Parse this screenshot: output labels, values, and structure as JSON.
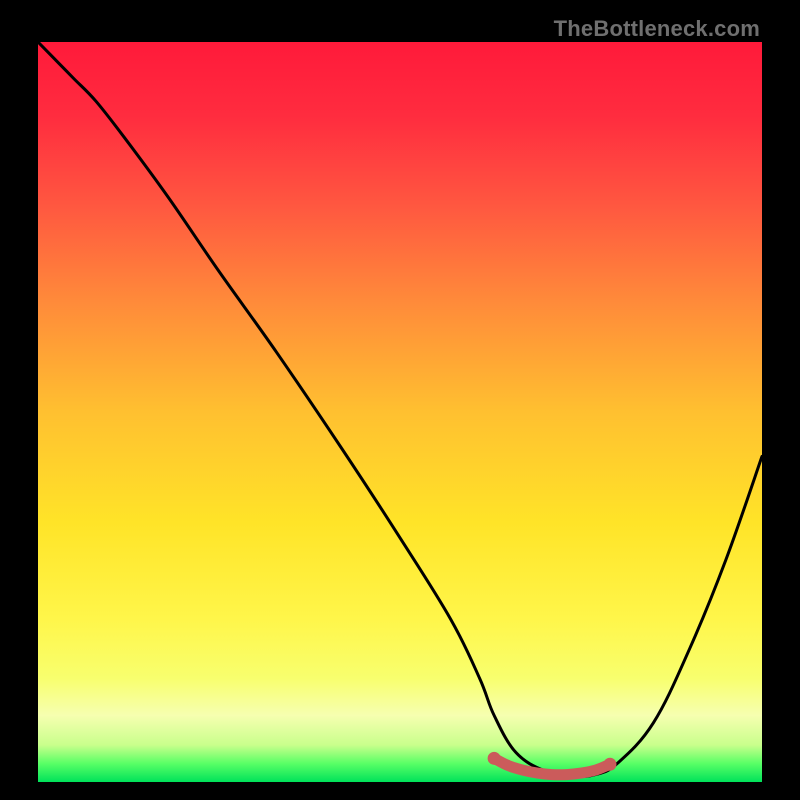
{
  "watermark": "TheBottleneck.com",
  "colors": {
    "bg": "#000000",
    "curve": "#000000",
    "marker": "#cb5b5b",
    "gradient_stops": [
      {
        "offset": 0.0,
        "color": "#ff1a3a"
      },
      {
        "offset": 0.1,
        "color": "#ff2c3f"
      },
      {
        "offset": 0.22,
        "color": "#ff5740"
      },
      {
        "offset": 0.35,
        "color": "#ff8a3a"
      },
      {
        "offset": 0.5,
        "color": "#ffc030"
      },
      {
        "offset": 0.65,
        "color": "#ffe428"
      },
      {
        "offset": 0.78,
        "color": "#fff64a"
      },
      {
        "offset": 0.86,
        "color": "#f8ff6e"
      },
      {
        "offset": 0.91,
        "color": "#f6ffb0"
      },
      {
        "offset": 0.95,
        "color": "#c9ff8c"
      },
      {
        "offset": 0.975,
        "color": "#59ff66"
      },
      {
        "offset": 1.0,
        "color": "#00e25a"
      }
    ]
  },
  "chart_data": {
    "type": "line",
    "title": "",
    "xlabel": "",
    "ylabel": "",
    "xlim": [
      0,
      100
    ],
    "ylim": [
      0,
      100
    ],
    "series": [
      {
        "name": "bottleneck-curve",
        "x": [
          0,
          3,
          5,
          8,
          12,
          18,
          25,
          33,
          42,
          50,
          57,
          61,
          63,
          66,
          70,
          74,
          77,
          80,
          85,
          90,
          95,
          100
        ],
        "y": [
          100,
          97,
          95,
          92,
          87,
          79,
          69,
          58,
          45,
          33,
          22,
          14,
          9,
          4,
          1.5,
          0.8,
          1.0,
          2.5,
          8,
          18,
          30,
          44
        ]
      }
    ],
    "markers": {
      "name": "optimal-region",
      "x": [
        63,
        65,
        67,
        69,
        71,
        73,
        75,
        77,
        79
      ],
      "y": [
        3.2,
        2.2,
        1.6,
        1.2,
        1.0,
        1.0,
        1.2,
        1.6,
        2.4
      ]
    }
  }
}
